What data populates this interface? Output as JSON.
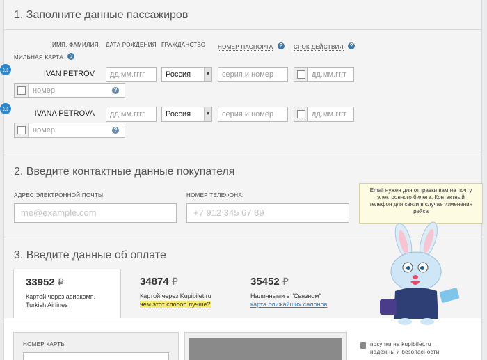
{
  "section1": {
    "title": "1. Заполните данные пассажиров",
    "columns": {
      "name": "имя, фамилия",
      "birth": "дата рождения",
      "citizenship": "гражданство",
      "passport": "номер паспорта",
      "validity": "срок действия",
      "miles": "мильная карта"
    },
    "passengers": [
      {
        "name": "IVAN PETROV",
        "birth_placeholder": "дд.мм.гггг",
        "citizenship": "Россия",
        "passport_placeholder": "серия и номер",
        "validity_placeholder": "дд.мм.гггг",
        "miles_placeholder": "номер"
      },
      {
        "name": "IVANA PETROVA",
        "birth_placeholder": "дд.мм.гггг",
        "citizenship": "Россия",
        "passport_placeholder": "серия и номер",
        "validity_placeholder": "дд.мм.гггг",
        "miles_placeholder": "номер"
      }
    ]
  },
  "section2": {
    "title": "2. Введите контактные данные покупателя",
    "email_label": "адрес электронной почты:",
    "email_placeholder": "me@example.com",
    "phone_label": "номер телефона:",
    "phone_placeholder": "+7 912 345 67 89",
    "tooltip": "Email нужен для отправки вам на почту электронного билета. Контактный телефон для связи в случае изменения рейса"
  },
  "section3": {
    "title": "3. Введите данные об оплате",
    "currency": "₽",
    "methods": [
      {
        "price": "33952",
        "line1": "Картой через авиакомп.",
        "line2": "Turkish Airlines"
      },
      {
        "price": "34874",
        "line1": "Картой через Kupibilet.ru",
        "line2": "чем этот способ лучше?"
      },
      {
        "price": "35452",
        "line1": "Наличными в \"Связном\"",
        "line2": "карта ближайших салонов"
      }
    ],
    "card_number_label": "номер карты",
    "secure_line1": "покупки на kupibilet.ru",
    "secure_line2": "надежны и безопасности"
  },
  "help_symbol": "?",
  "colors": {
    "accent": "#2f7cbe",
    "highlight": "#f5ea72",
    "icon_blue": "#2d86c9"
  },
  "icons": [
    "person-icon",
    "help-icon",
    "dropdown-arrow-icon",
    "lock-icon",
    "bunny-mascot"
  ]
}
